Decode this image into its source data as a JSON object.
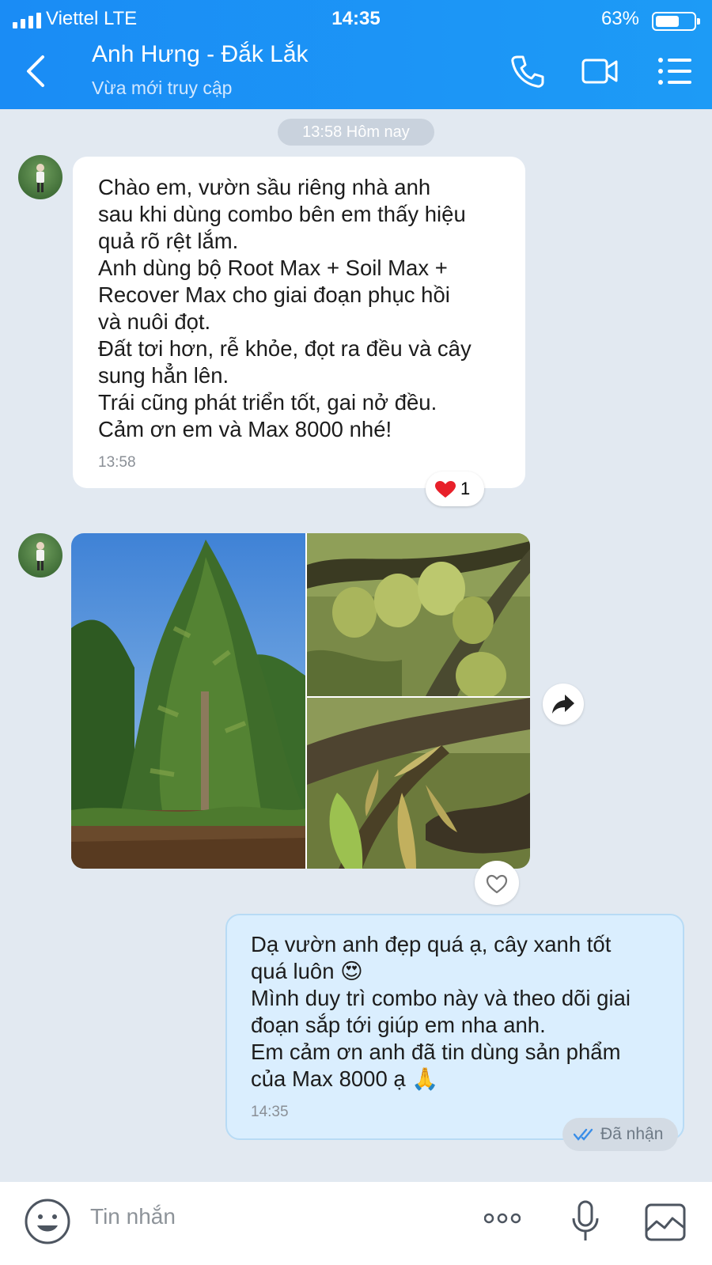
{
  "status_bar": {
    "carrier": "Viettel  LTE",
    "time": "14:35",
    "battery": "63%",
    "battery_level": 0.63
  },
  "header": {
    "title": "Anh Hưng - Đắk Lắk",
    "subtitle": "Vừa mới truy cập"
  },
  "date_chip": "13:58 Hôm nay",
  "messages": [
    {
      "text": "Chào em, vườn sầu riêng nhà anh\nsau khi dùng combo bên em thấy hiệu\nquả rõ rệt lắm.\nAnh dùng bộ Root Max + Soil Max +\nRecover Max cho giai đoạn phục hồi\nvà nuôi đọt.\nĐất tơi hơn, rễ khỏe, đọt ra đều và cây\nsung hẳn lên.\nTrái cũng phát triển tốt, gai nở đều.\nCảm ơn em và Max 8000 nhé!",
      "time": "13:58",
      "reaction_count": "1"
    },
    {
      "text": "Dạ vườn anh đẹp quá ạ, cây xanh tốt\nquá luôn 😍\nMình duy trì combo này và theo dõi giai\nđoạn sắp tới giúp em nha anh.\nEm cảm ơn anh đã tin dùng sản phẩm\ncủa Max 8000 ạ 🙏",
      "time": "14:35",
      "status": "Đã nhận"
    }
  ],
  "composer": {
    "placeholder": "Tin nhắn"
  },
  "icons": [
    "signal-icon",
    "battery-icon",
    "back-icon",
    "phone-icon",
    "video-icon",
    "menu-icon",
    "heart-icon",
    "share-icon",
    "like-icon",
    "check-icon",
    "emoji-icon",
    "more-icon",
    "mic-icon",
    "image-icon"
  ],
  "colors": {
    "header": "#1a8cf5",
    "background": "#e2e9f1",
    "outgoing_bubble": "#daeefe"
  }
}
